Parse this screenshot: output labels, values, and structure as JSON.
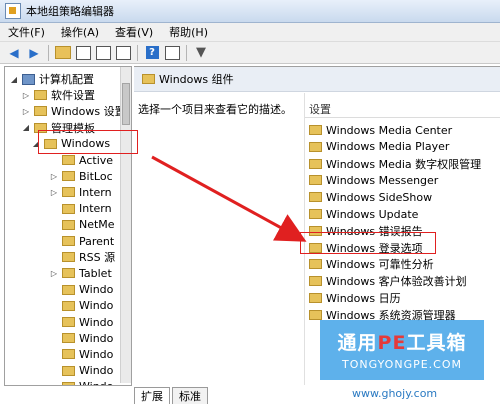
{
  "window": {
    "title": "本地组策略编辑器"
  },
  "menu": [
    "文件(F)",
    "操作(A)",
    "查看(V)",
    "帮助(H)"
  ],
  "tree": {
    "items": [
      {
        "label": "计算机配置",
        "expand": "◢",
        "icon": "computer-icon",
        "indent": 0
      },
      {
        "label": "软件设置",
        "expand": "▷",
        "icon": "folder-icon",
        "indent": 1
      },
      {
        "label": "Windows 设置",
        "expand": "▷",
        "icon": "folder-icon",
        "indent": 1
      },
      {
        "label": "管理模板",
        "expand": "◢",
        "icon": "folder-icon",
        "indent": 1
      },
      {
        "label": "Windows",
        "expand": "◢",
        "icon": "folder-icon",
        "indent": 2
      },
      {
        "label": "Active",
        "expand": "",
        "icon": "folder-icon",
        "indent": 3
      },
      {
        "label": "BitLoc",
        "expand": "▷",
        "icon": "folder-icon",
        "indent": 3
      },
      {
        "label": "Intern",
        "expand": "▷",
        "icon": "folder-icon",
        "indent": 3
      },
      {
        "label": "Intern",
        "expand": "",
        "icon": "folder-icon",
        "indent": 3
      },
      {
        "label": "NetMe",
        "expand": "",
        "icon": "folder-icon",
        "indent": 3
      },
      {
        "label": "Parent",
        "expand": "",
        "icon": "folder-icon",
        "indent": 3
      },
      {
        "label": "RSS 源",
        "expand": "",
        "icon": "folder-icon",
        "indent": 3
      },
      {
        "label": "Tablet",
        "expand": "▷",
        "icon": "folder-icon",
        "indent": 3
      },
      {
        "label": "Windo",
        "expand": "",
        "icon": "folder-icon",
        "indent": 3
      },
      {
        "label": "Windo",
        "expand": "",
        "icon": "folder-icon",
        "indent": 3
      },
      {
        "label": "Windo",
        "expand": "",
        "icon": "folder-icon",
        "indent": 3
      },
      {
        "label": "Windo",
        "expand": "",
        "icon": "folder-icon",
        "indent": 3
      },
      {
        "label": "Windo",
        "expand": "",
        "icon": "folder-icon",
        "indent": 3
      },
      {
        "label": "Windo",
        "expand": "",
        "icon": "folder-icon",
        "indent": 3
      },
      {
        "label": "Windo",
        "expand": "",
        "icon": "folder-icon",
        "indent": 3
      }
    ]
  },
  "right": {
    "header": "Windows 组件",
    "description": "选择一个项目来查看它的描述。",
    "column_header": "设置",
    "items": [
      "Windows Media Center",
      "Windows Media Player",
      "Windows Media 数字权限管理",
      "Windows Messenger",
      "Windows SideShow",
      "Windows Update",
      "Windows 错误报告",
      "Windows 登录选项",
      "Windows 可靠性分析",
      "Windows 客户体验改善计划",
      "Windows 日历",
      "Windows 系统资源管理器"
    ]
  },
  "tabs": [
    "扩展",
    "标准"
  ],
  "watermark": {
    "title_a": "通用",
    "title_pe": "PE",
    "title_b": "工具箱",
    "subtitle": "TONGYONGPE.COM",
    "url": "www.ghojy.com"
  },
  "colors": {
    "highlight": "#e02020",
    "folder": "#e6c25a",
    "accent": "#2a6fc9"
  }
}
